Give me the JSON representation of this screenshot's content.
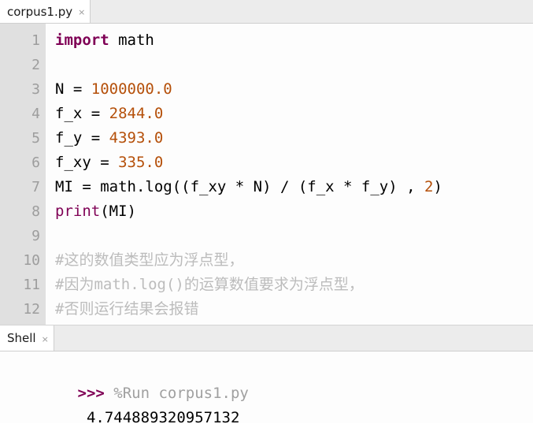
{
  "editor": {
    "tab": {
      "label": "corpus1.py",
      "close_icon": "×"
    },
    "gutter_numbers": [
      "1",
      "2",
      "3",
      "4",
      "5",
      "6",
      "7",
      "8",
      "9",
      "10",
      "11",
      "12"
    ],
    "lines": [
      {
        "n": "1",
        "segments": [
          {
            "t": "import",
            "k": "kw"
          },
          {
            "t": " math",
            "k": "plain"
          }
        ]
      },
      {
        "n": "2",
        "segments": [
          {
            "t": "",
            "k": "plain"
          }
        ]
      },
      {
        "n": "3",
        "segments": [
          {
            "t": "N = ",
            "k": "plain"
          },
          {
            "t": "1000000.0",
            "k": "num"
          }
        ]
      },
      {
        "n": "4",
        "segments": [
          {
            "t": "f_x = ",
            "k": "plain"
          },
          {
            "t": "2844.0",
            "k": "num"
          }
        ]
      },
      {
        "n": "5",
        "segments": [
          {
            "t": "f_y = ",
            "k": "plain"
          },
          {
            "t": "4393.0",
            "k": "num"
          }
        ]
      },
      {
        "n": "6",
        "segments": [
          {
            "t": "f_xy = ",
            "k": "plain"
          },
          {
            "t": "335.0",
            "k": "num"
          }
        ]
      },
      {
        "n": "7",
        "segments": [
          {
            "t": "MI = math.log((f_xy * N) / (f_x * f_y) , ",
            "k": "plain"
          },
          {
            "t": "2",
            "k": "num"
          },
          {
            "t": ")",
            "k": "plain"
          }
        ]
      },
      {
        "n": "8",
        "segments": [
          {
            "t": "print",
            "k": "builtin"
          },
          {
            "t": "(MI)",
            "k": "plain"
          }
        ]
      },
      {
        "n": "9",
        "segments": [
          {
            "t": "",
            "k": "plain"
          }
        ]
      },
      {
        "n": "10",
        "segments": [
          {
            "t": "#这的数值类型应为浮点型，",
            "k": "comment"
          }
        ]
      },
      {
        "n": "11",
        "segments": [
          {
            "t": "#因为math.log()的运算数值要求为浮点型，",
            "k": "comment"
          }
        ]
      },
      {
        "n": "12",
        "segments": [
          {
            "t": "#否则运行结果会报错",
            "k": "comment"
          }
        ]
      }
    ]
  },
  "shell": {
    "tab": {
      "label": "Shell",
      "close_icon": "×"
    },
    "prompt": ">>>",
    "command": " %Run corpus1.py",
    "output": " 4.744889320957132"
  },
  "colors": {
    "keyword": "#7f0055",
    "number": "#b5500a",
    "comment": "#bcbcbc",
    "tabbar_bg": "#ececec",
    "gutter_bg": "#e0e0e0",
    "editor_bg": "#fdfdfd"
  }
}
